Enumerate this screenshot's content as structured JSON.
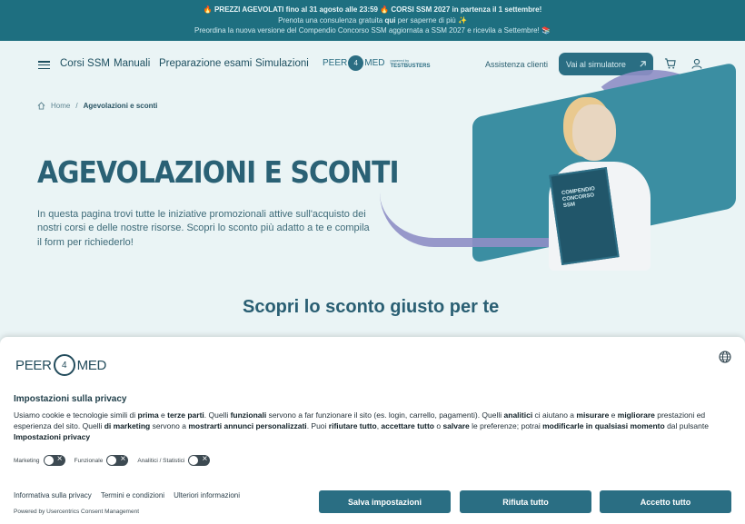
{
  "promo": {
    "line1": "🔥 PREZZI AGEVOLATI fino al 31 agosto alle 23:59 🔥 CORSI SSM 2027 in partenza il 1 settembre!",
    "line2_pre": "Prenota una consulenza gratuita ",
    "line2_link": "qui",
    "line2_post": " per saperne di più ✨",
    "line3": "Preordina la nuova versione del Compendio Concorso SSM aggiornata a SSM 2027 e ricevila a Settembre! 📚"
  },
  "nav": {
    "menu_icon": "hamburger-icon",
    "links": [
      "Corsi SSM",
      "Manuali",
      "Preparazione esami",
      "Simulazioni"
    ],
    "logo_left": "PEER",
    "logo_mark": "4",
    "logo_right": "MED",
    "logo_sub1": "powered by",
    "logo_sub2": "TESTBUSTERS",
    "assist": "Assistenza clienti",
    "sim_button": "Vai al simulatore",
    "cart_icon": "cart-icon",
    "user_icon": "user-icon"
  },
  "breadcrumb": {
    "home": "Home",
    "sep": "/",
    "current": "Agevolazioni e sconti"
  },
  "hero": {
    "title": "AGEVOLAZIONI E SCONTI",
    "lead": "In questa pagina trovi tutte le iniziative promozionali attive sull'acquisto dei nostri corsi e delle nostre risorse. Scopri lo sconto più adatto a te e compila il form per richiederlo!",
    "book_title": "COMPENDIO CONCORSO SSM"
  },
  "section_title": "Scopri lo sconto giusto per te",
  "consent": {
    "logo_left": "PEER",
    "logo_mark": "4",
    "logo_right": "MED",
    "title": "Impostazioni sulla privacy",
    "text": {
      "p1": "Usiamo cookie e tecnologie simili di ",
      "b1": "prima",
      "p2": " e ",
      "b2": "terze parti",
      "p3": ". Quelli ",
      "b3": "funzionali",
      "p4": " servono a far funzionare il sito (es. login, carrello, pagamenti). Quelli ",
      "b4": "analitici",
      "p5": " ci aiutano a ",
      "b5": "misurare",
      "p6": " e ",
      "b6": "migliorare",
      "p7": " prestazioni ed esperienza del sito. Quelli ",
      "b7": "di marketing",
      "p8": " servono a ",
      "b8": "mostrarti annunci personalizzati",
      "p9": ". Puoi ",
      "b9": "rifiutare tutto",
      "p10": ", ",
      "b10": "accettare tutto",
      "p11": " o ",
      "b11": "salvare",
      "p12": " le preferenze; potrai ",
      "b12": "modificarle in qualsiasi momento",
      "p13": " dal pulsante ",
      "b13": "Impostazioni privacy"
    },
    "toggles": [
      "Marketing",
      "Funzionale",
      "Analitici / Statistici"
    ],
    "links": [
      "Informativa sulla privacy",
      "Termini e condizioni",
      "Ulteriori informazioni"
    ],
    "powered": "Powered by Usercentrics Consent Management",
    "buttons": {
      "save": "Salva impostazioni",
      "reject": "Rifiuta tutto",
      "accept": "Accetto tutto"
    },
    "globe_icon": "globe-icon"
  },
  "colors": {
    "primary": "#2a6e83",
    "promo_bg": "#1e6f80",
    "accent_purple": "#8f8fc6"
  }
}
